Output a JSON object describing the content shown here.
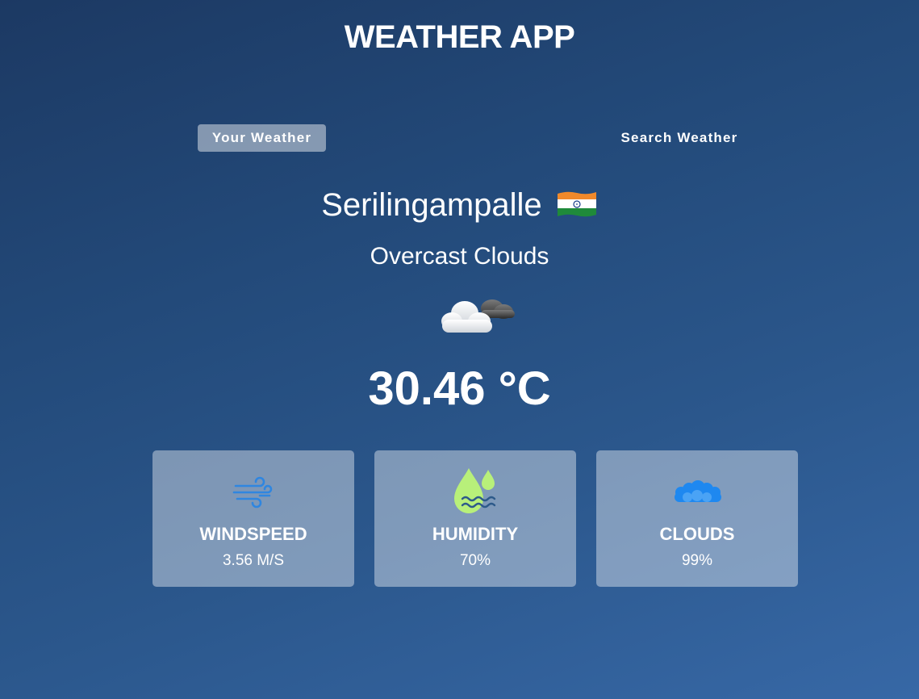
{
  "header": {
    "title": "WEATHER APP"
  },
  "tabs": [
    {
      "label": "Your Weather",
      "active": true
    },
    {
      "label": "Search Weather",
      "active": false
    }
  ],
  "location": {
    "city": "Serilingampalle",
    "flag_icon": "india-flag-icon"
  },
  "weather": {
    "description": "Overcast Clouds",
    "icon": "overcast-clouds-icon",
    "temperature": "30.46 °C"
  },
  "stats": [
    {
      "label": "WINDSPEED",
      "value": "3.56 M/S",
      "icon": "wind-icon"
    },
    {
      "label": "HUMIDITY",
      "value": "70%",
      "icon": "humidity-icon"
    },
    {
      "label": "CLOUDS",
      "value": "99%",
      "icon": "clouds-icon"
    }
  ],
  "colors": {
    "background_top": "#1c3963",
    "background_bottom": "#3768a6",
    "wind_icon": "#2f86e0",
    "humidity_icon": "#b8f07a",
    "clouds_icon": "#1e88f0"
  }
}
